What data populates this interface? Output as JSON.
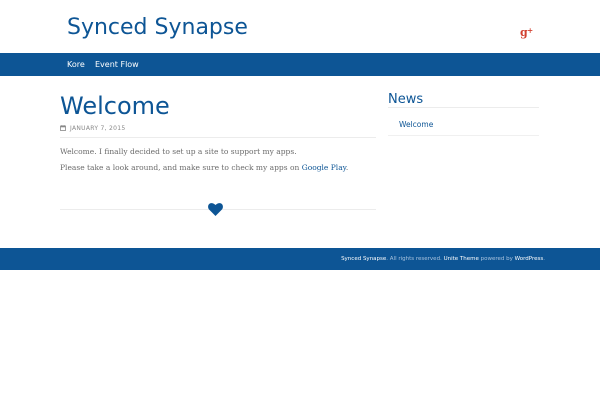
{
  "site": {
    "title": "Synced Synapse",
    "social_icon": "google-plus-icon",
    "social_label": "g",
    "social_plus": "+"
  },
  "nav": {
    "items": [
      {
        "label": "Kore"
      },
      {
        "label": "Event Flow"
      }
    ]
  },
  "post": {
    "title": "Welcome",
    "date": "JANUARY 7, 2015",
    "date_icon": "calendar-icon",
    "paragraph1": "Welcome. I finally decided to set up a site to support my apps.",
    "paragraph2_prefix": "Please take a look around, and make sure to check my apps on ",
    "paragraph2_link": "Google Play",
    "paragraph2_suffix": ".",
    "footer_icon": "heart-icon"
  },
  "sidebar": {
    "widget_title": "News",
    "items": [
      {
        "label": "Welcome"
      }
    ]
  },
  "footer": {
    "site_name": "Synced Synapse",
    "rights": ". All rights reserved.",
    "theme_link": "Unite Theme",
    "powered_by": "powered by",
    "wp_link": "WordPress",
    "end": "."
  },
  "colors": {
    "brand": "#0d5595",
    "text": "#6b6b6b",
    "gplus": "#d2402f"
  }
}
